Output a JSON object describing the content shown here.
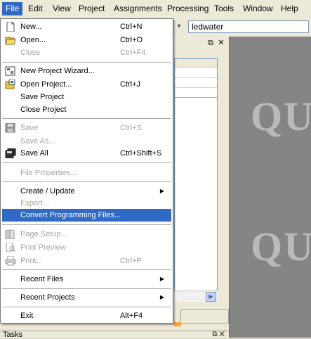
{
  "menubar": {
    "items": [
      {
        "label": "File",
        "active": true
      },
      {
        "label": "Edit"
      },
      {
        "label": "View"
      },
      {
        "label": "Project"
      },
      {
        "label": "Assignments"
      },
      {
        "label": "Processing"
      },
      {
        "label": "Tools"
      },
      {
        "label": "Window"
      },
      {
        "label": "Help"
      }
    ]
  },
  "toolbar": {
    "entity_value": "ledwater"
  },
  "panel": {
    "restore_glyph": "⧉",
    "close_glyph": "✕"
  },
  "tasks": {
    "label": "Tasks",
    "restore_glyph": "⧉",
    "close_glyph": "✕"
  },
  "watermark": {
    "text": "QU"
  },
  "file_menu": {
    "items": [
      {
        "label": "New...",
        "shortcut": "Ctrl+N",
        "icon": "new-file-icon",
        "enabled": true
      },
      {
        "label": "Open...",
        "shortcut": "Ctrl+O",
        "icon": "open-folder-icon",
        "enabled": true
      },
      {
        "label": "Close",
        "shortcut": "Ctrl+F4",
        "enabled": false
      },
      {
        "label": "New Project Wizard...",
        "icon": "wizard-icon",
        "enabled": true
      },
      {
        "label": "Open Project...",
        "shortcut": "Ctrl+J",
        "icon": "open-project-icon",
        "enabled": true
      },
      {
        "label": "Save Project",
        "enabled": true
      },
      {
        "label": "Close Project",
        "enabled": true
      },
      {
        "label": "Save",
        "shortcut": "Ctrl+S",
        "icon": "save-icon",
        "enabled": false
      },
      {
        "label": "Save As...",
        "enabled": false
      },
      {
        "label": "Save All",
        "shortcut": "Ctrl+Shift+S",
        "icon": "save-all-icon",
        "enabled": true
      },
      {
        "label": "File Properties...",
        "enabled": false
      },
      {
        "label": "Create / Update",
        "submenu": true,
        "enabled": true
      },
      {
        "label": "Export...",
        "enabled": false
      },
      {
        "label": "Convert Programming Files...",
        "enabled": true,
        "highlighted": true
      },
      {
        "label": "Page Setup...",
        "icon": "page-setup-icon",
        "enabled": false
      },
      {
        "label": "Print Preview",
        "icon": "print-preview-icon",
        "enabled": false
      },
      {
        "label": "Print...",
        "shortcut": "Ctrl+P",
        "icon": "print-icon",
        "enabled": false
      },
      {
        "label": "Recent Files",
        "submenu": true,
        "enabled": true
      },
      {
        "label": "Recent Projects",
        "submenu": true,
        "enabled": true
      },
      {
        "label": "Exit",
        "shortcut": "Alt+F4",
        "enabled": true
      }
    ]
  },
  "colors": {
    "menu_highlight": "#316ac5",
    "disabled_text": "#a7a59a",
    "watermark_bg": "#858585"
  }
}
